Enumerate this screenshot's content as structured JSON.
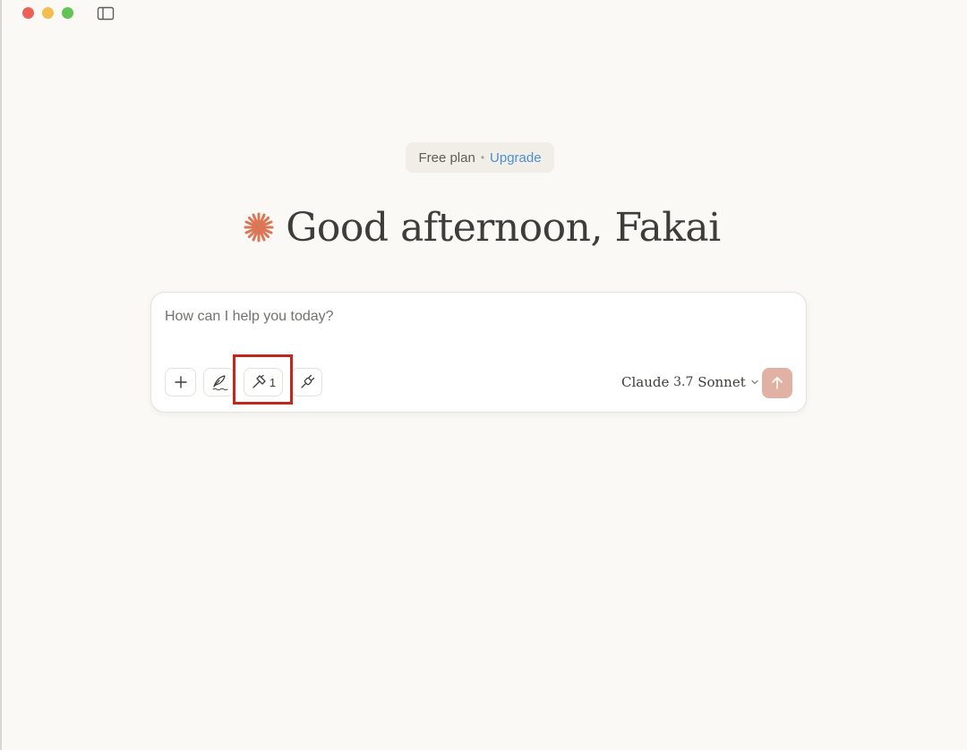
{
  "window": {
    "traffic_lights": [
      "close",
      "minimize",
      "zoom"
    ],
    "colors": {
      "close": "#ee5f57",
      "minimize": "#f4bd4f",
      "zoom": "#61c454"
    },
    "sidebar_toggle_icon": "sidebar-toggle-icon"
  },
  "plan": {
    "label": "Free plan",
    "separator": "•",
    "upgrade_label": "Upgrade"
  },
  "greeting": {
    "text": "Good afternoon, Fakai",
    "icon": "starburst-logo-icon",
    "accent_color": "#d97757"
  },
  "composer": {
    "placeholder": "How can I help you today?",
    "value": "",
    "buttons": {
      "add_icon": "plus-icon",
      "style_icon": "quill-pen-icon",
      "tools_icon": "hammer-icon",
      "tools_count": "1",
      "integrations_icon": "plug-icon"
    },
    "model": {
      "name_prefix": "Claude",
      "version": "3.7",
      "name_suffix": "Sonnet"
    },
    "send_icon": "arrow-up-icon",
    "send_color": "#e1b2a4"
  },
  "annotation": {
    "highlight_color": "#c0281e",
    "highlight_target": "tools-button"
  }
}
